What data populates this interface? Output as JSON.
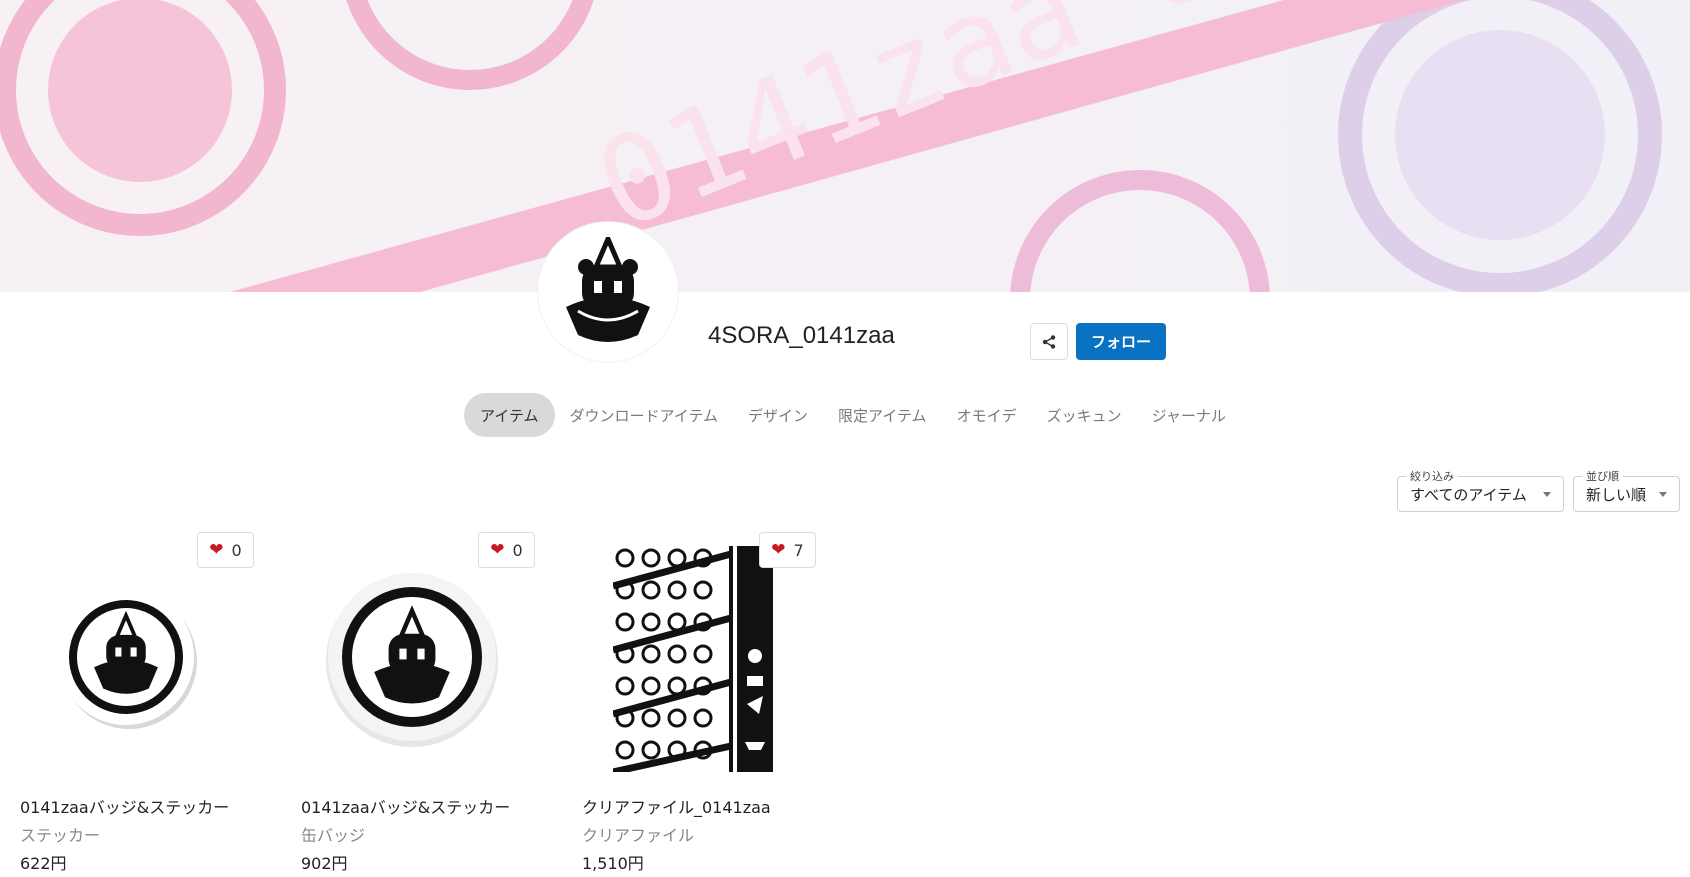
{
  "banner": {
    "text": "0141zaa 0141zaa"
  },
  "shop": {
    "name": "4SORA_0141zaa"
  },
  "actions": {
    "share_icon": "share-icon",
    "follow_label": "フォロー"
  },
  "tabs": [
    {
      "label": "アイテム",
      "active": true
    },
    {
      "label": "ダウンロードアイテム",
      "active": false
    },
    {
      "label": "デザイン",
      "active": false
    },
    {
      "label": "限定アイテム",
      "active": false
    },
    {
      "label": "オモイデ",
      "active": false
    },
    {
      "label": "ズッキュン",
      "active": false
    },
    {
      "label": "ジャーナル",
      "active": false
    }
  ],
  "filters": {
    "filter": {
      "legend": "絞り込み",
      "value": "すべてのアイテム"
    },
    "sort": {
      "legend": "並び順",
      "value": "新しい順"
    }
  },
  "products": [
    {
      "title": "0141zaaバッジ&ステッカー",
      "category": "ステッカー",
      "price": "622円",
      "likes": "0"
    },
    {
      "title": "0141zaaバッジ&ステッカー",
      "category": "缶バッジ",
      "price": "902円",
      "likes": "0"
    },
    {
      "title": "クリアファイル_0141zaa",
      "category": "クリアファイル",
      "price": "1,510円",
      "likes": "7"
    }
  ],
  "colors": {
    "accent": "#0a72c2",
    "heart": "#c8191f",
    "banner_pink": "#f2a9c9",
    "banner_lavender": "#d9cde8"
  }
}
